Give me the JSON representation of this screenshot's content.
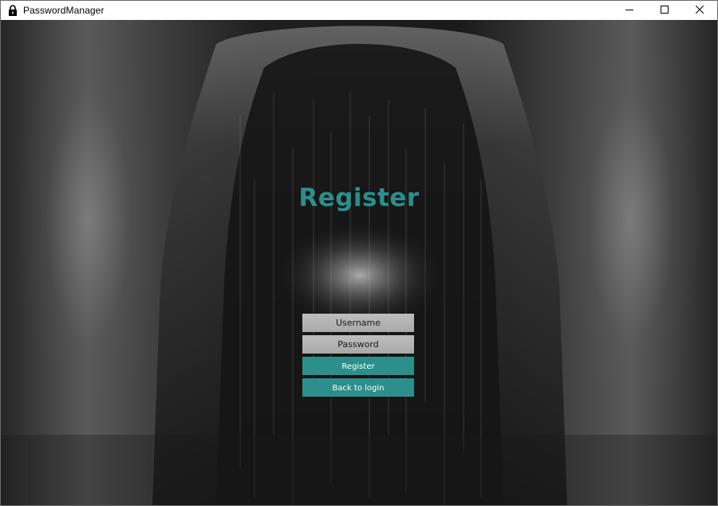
{
  "window": {
    "title": "PasswordManager",
    "app_icon": "lock-icon",
    "controls": {
      "minimize_icon": "minimize-icon",
      "maximize_icon": "maximize-icon",
      "close_icon": "close-icon"
    }
  },
  "form": {
    "heading": "Register",
    "username_placeholder": "Username",
    "password_placeholder": "Password",
    "register_label": "Register",
    "back_label": "Back to login"
  },
  "colors": {
    "accent": "#2c8f8c",
    "field_background": "#b3b3b3",
    "background": "#1e1e1e"
  }
}
